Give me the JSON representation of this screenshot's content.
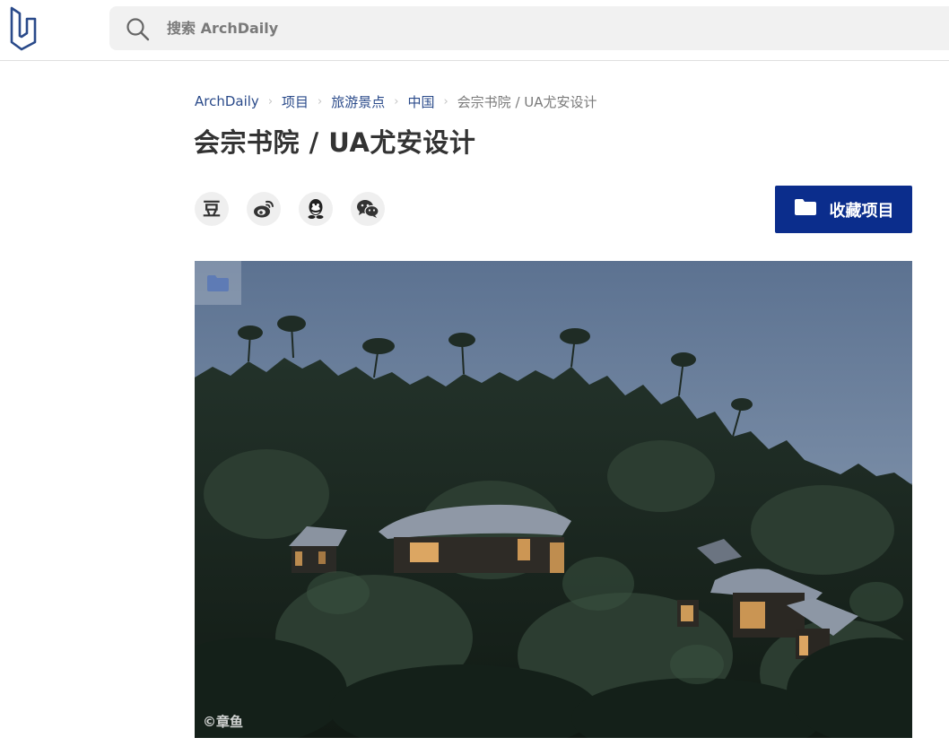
{
  "header": {
    "logo_icon": "archdaily-logo-icon",
    "search": {
      "icon": "search-icon",
      "placeholder": "搜索 ArchDaily",
      "value": ""
    }
  },
  "breadcrumb": {
    "items": [
      "ArchDaily",
      "项目",
      "旅游景点",
      "中国"
    ],
    "current": "会宗书院 / UA尤安设计"
  },
  "page": {
    "title": "会宗书院 / UA尤安设计"
  },
  "share": {
    "douban_glyph": "豆",
    "items": [
      "douban-icon",
      "weibo-icon",
      "qq-icon",
      "wechat-icon"
    ]
  },
  "bookmark": {
    "label": "收藏项目",
    "icon": "folder-icon",
    "bg_color": "#0b2d8c"
  },
  "hero": {
    "save_icon": "folder-icon",
    "credit": "©章鱼"
  }
}
